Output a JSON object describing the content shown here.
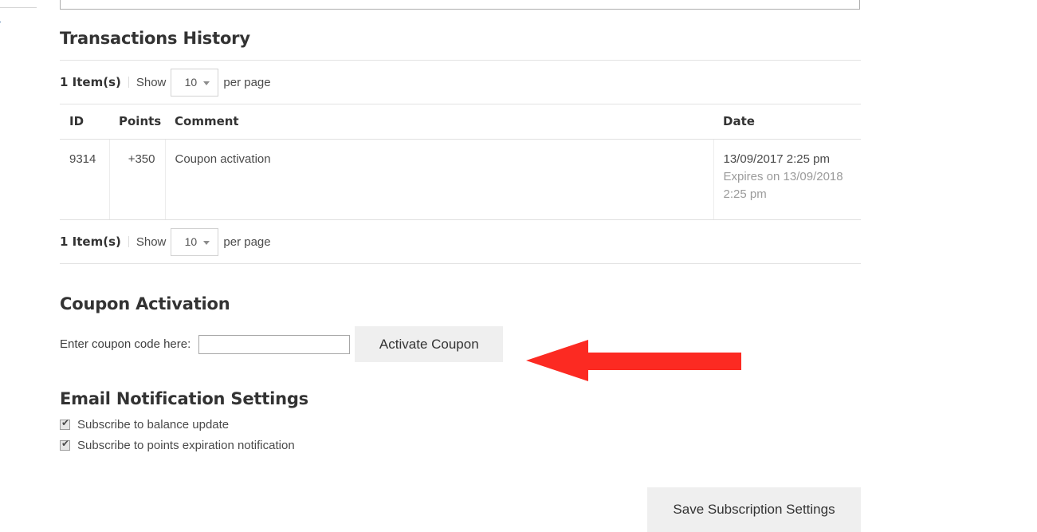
{
  "sidebar": {
    "clipped_label": "r"
  },
  "transactions": {
    "title": "Transactions History",
    "pager_top": {
      "count_label": "1 Item(s)",
      "show_label": "Show",
      "limit_value": "10",
      "per_page_label": "per page",
      "caret_icon": "chevron-down-icon"
    },
    "pager_bottom": {
      "count_label": "1 Item(s)",
      "show_label": "Show",
      "limit_value": "10",
      "per_page_label": "per page",
      "caret_icon": "chevron-down-icon"
    },
    "columns": [
      "ID",
      "Points",
      "Comment",
      "Date"
    ],
    "rows": [
      {
        "id": "9314",
        "points": "+350",
        "comment": "Coupon activation",
        "date_primary": "13/09/2017 2:25 pm",
        "date_expires": "Expires on 13/09/2018 2:25 pm"
      }
    ]
  },
  "coupon": {
    "title": "Coupon Activation",
    "field_label": "Enter coupon code here:",
    "input_value": "",
    "input_placeholder": "",
    "activate_button": "Activate Coupon"
  },
  "email_notifications": {
    "title": "Email Notification Settings",
    "options": [
      {
        "label": "Subscribe to balance update",
        "checked": true,
        "tick": "✔"
      },
      {
        "label": "Subscribe to points expiration notification",
        "checked": true,
        "tick": "✔"
      }
    ],
    "save_button": "Save Subscription Settings"
  },
  "annotation": {
    "arrow_icon": "left-arrow-icon",
    "color": "#FC2A22",
    "points_to": "Activate Coupon"
  },
  "colors": {
    "heading": "#333333",
    "body_text": "#4a4a4a",
    "muted_text": "#9b9b9b",
    "rule": "#e3e3e3",
    "button_bg": "#efefef",
    "accent_red": "#FC2A22"
  }
}
